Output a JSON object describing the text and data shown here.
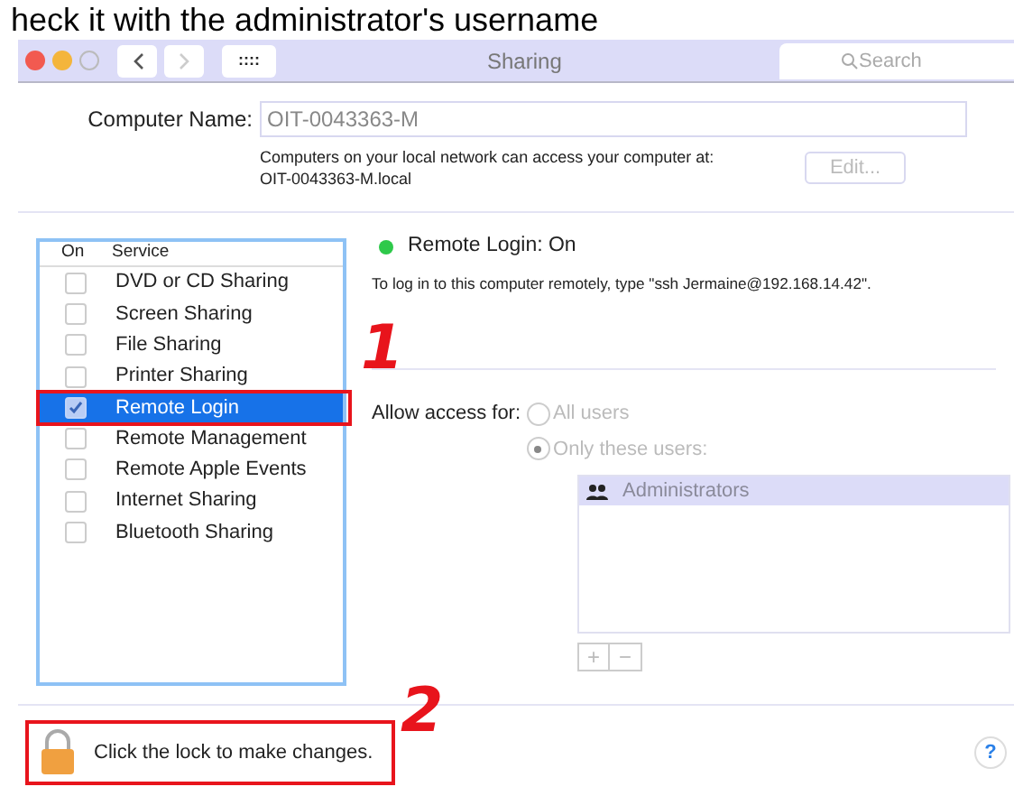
{
  "caption": "heck it with the administrator's username",
  "window": {
    "title": "Sharing",
    "search": {
      "placeholder": "Search"
    },
    "grid_button": "::::"
  },
  "computer_name": {
    "label": "Computer Name:",
    "value": "OIT-0043363-M",
    "info": "Computers on your local network can access your computer at:",
    "address": "OIT-0043363-M.local",
    "edit_button": "Edit..."
  },
  "services": {
    "columns": [
      "On",
      "Service"
    ],
    "rows": [
      {
        "name": "DVD or CD Sharing",
        "on": false,
        "selected": false
      },
      {
        "name": "Screen Sharing",
        "on": false,
        "selected": false
      },
      {
        "name": "File Sharing",
        "on": false,
        "selected": false
      },
      {
        "name": "Printer Sharing",
        "on": false,
        "selected": false
      },
      {
        "name": "Remote Login",
        "on": true,
        "selected": true
      },
      {
        "name": "Remote Management",
        "on": false,
        "selected": false
      },
      {
        "name": "Remote Apple Events",
        "on": false,
        "selected": false
      },
      {
        "name": "Internet Sharing",
        "on": false,
        "selected": false
      },
      {
        "name": "Bluetooth Sharing",
        "on": false,
        "selected": false
      }
    ]
  },
  "status": {
    "text": "Remote Login: On",
    "color": "#2ec94a",
    "instruction": "To log in to this computer remotely, type \"ssh Jermaine@192.168.14.42\"."
  },
  "access": {
    "label": "Allow access for:",
    "options": [
      {
        "label": "All users",
        "selected": false
      },
      {
        "label": "Only these users:",
        "selected": true
      }
    ],
    "users": [
      {
        "name": "Administrators",
        "selected": true
      }
    ],
    "add_button": "+",
    "remove_button": "−"
  },
  "footer": {
    "lock_text": "Click the lock to make changes.",
    "help_button": "?"
  },
  "annotations": [
    {
      "label": "1"
    },
    {
      "label": "2"
    }
  ]
}
